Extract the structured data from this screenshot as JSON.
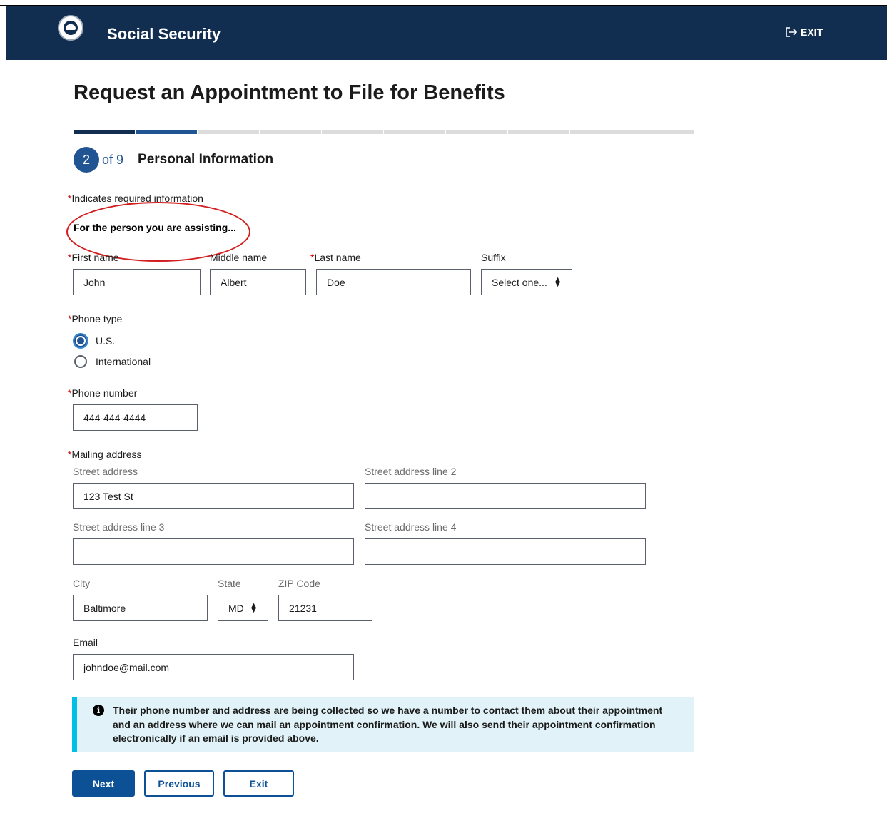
{
  "header": {
    "brand": "Social Security",
    "exit_label": "EXIT"
  },
  "page": {
    "title": "Request an Appointment to File for Benefits"
  },
  "progress": {
    "current_step": 2,
    "total_steps": 9
  },
  "step": {
    "number": "2",
    "of_label": "of 9",
    "title": "Personal Information"
  },
  "required_note": {
    "asterisk": "*",
    "text": "Indicates required information"
  },
  "section": {
    "assisting_text": "For the person you are assisting..."
  },
  "name": {
    "first_label": "First name",
    "first_value": "John",
    "middle_label": "Middle name",
    "middle_value": "Albert",
    "last_label": "Last name",
    "last_value": "Doe",
    "suffix_label": "Suffix",
    "suffix_value": "Select one..."
  },
  "phone_type": {
    "label": "Phone type",
    "options": [
      {
        "label": "U.S.",
        "checked": true
      },
      {
        "label": "International",
        "checked": false
      }
    ]
  },
  "phone": {
    "label": "Phone number",
    "value": "444-444-4444"
  },
  "address": {
    "label": "Mailing address",
    "street1_label": "Street address",
    "street1_value": "123 Test St",
    "street2_label": "Street address line 2",
    "street2_value": "",
    "street3_label": "Street address line 3",
    "street3_value": "",
    "street4_label": "Street address line 4",
    "street4_value": "",
    "city_label": "City",
    "city_value": "Baltimore",
    "state_label": "State",
    "state_value": "MD",
    "zip_label": "ZIP Code",
    "zip_value": "21231"
  },
  "email": {
    "label": "Email",
    "value": "johndoe@mail.com"
  },
  "alert": {
    "icon": "info-icon",
    "text": "Their phone number and address are being collected so we have a number to contact them about their appointment and an address where we can mail an appointment confirmation. We will also send their appointment confirmation electronically if an email is provided above."
  },
  "buttons": {
    "next": "Next",
    "previous": "Previous",
    "exit": "Exit"
  },
  "colors": {
    "header": "#112e51",
    "primary": "#0c5196",
    "required": "#cc0000",
    "alert_bg": "#e1f3f8",
    "alert_border": "#02bfe7"
  }
}
